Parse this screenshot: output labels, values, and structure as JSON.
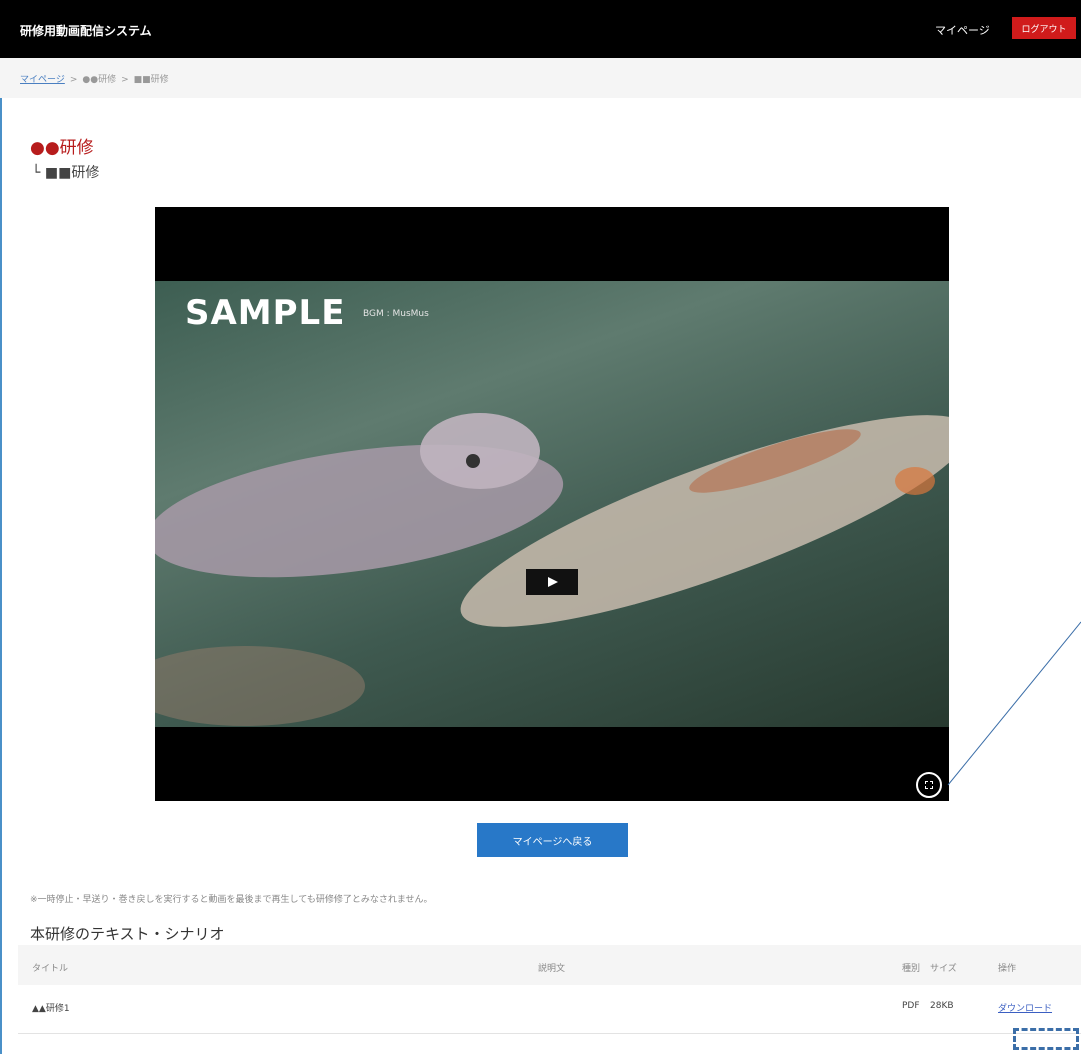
{
  "header": {
    "app_title": "研修用動画配信システム",
    "mypage_label": "マイページ",
    "logout_label": "ログアウト"
  },
  "breadcrumb": {
    "items": [
      "マイページ",
      "●●研修",
      "■■研修"
    ],
    "separator": ">"
  },
  "course": {
    "title": "●●研修",
    "subtitle": "└ ■■研修"
  },
  "video": {
    "overlay_title": "SAMPLE",
    "overlay_sub": "BGM : MusMus",
    "play_icon": "play-icon",
    "fullscreen_icon": "fullscreen-icon"
  },
  "actions": {
    "back_label": "マイページへ戻る"
  },
  "notice": "※一時停止・早送り・巻き戻しを実行すると動画を最後まで再生しても研修修了とみなされません。",
  "materials": {
    "section_title": "本研修のテキスト・シナリオ",
    "columns": {
      "title": "タイトル",
      "description": "説明文",
      "type": "種別",
      "size": "サイズ",
      "operation": "操作"
    },
    "rows": [
      {
        "title": "▲▲研修1",
        "description": "",
        "type": "PDF",
        "size": "28KB",
        "operation": "ダウンロード"
      }
    ]
  },
  "colors": {
    "accent_red": "#d01b1b",
    "title_red": "#b71c1c",
    "button_blue": "#2878c8",
    "link_blue": "#3b5fc2"
  }
}
